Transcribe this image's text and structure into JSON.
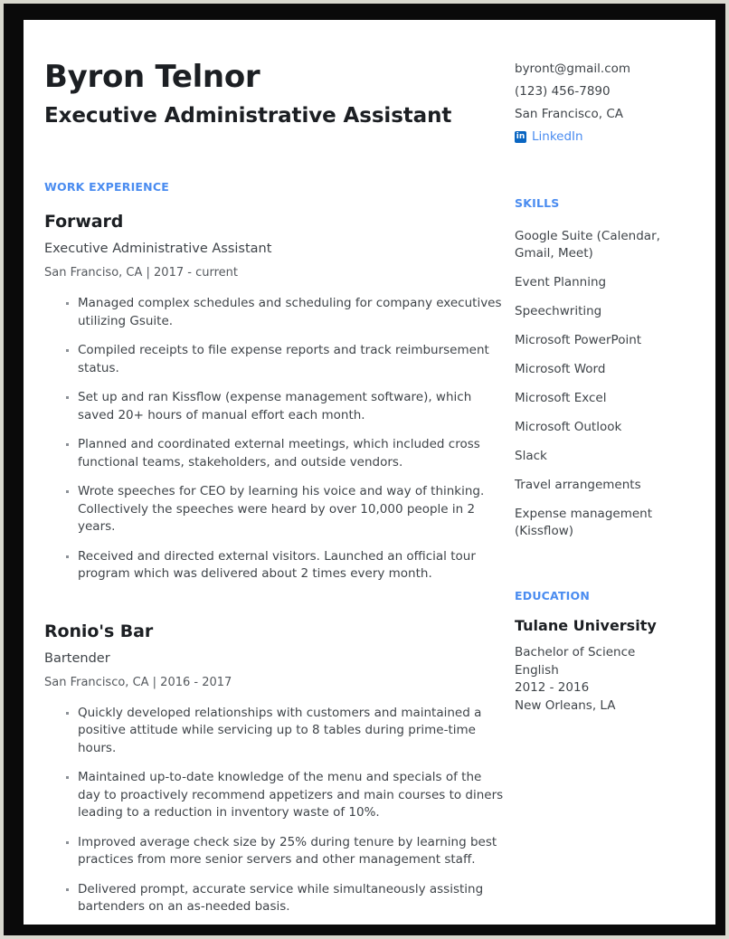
{
  "header": {
    "name": "Byron Telnor",
    "headline": "Executive Administrative Assistant"
  },
  "contact": {
    "email": "byront@gmail.com",
    "phone": "(123) 456-7890",
    "location": "San Francisco, CA",
    "linkedin_label": "LinkedIn",
    "linkedin_icon": "linkedin-icon",
    "link_color": "#4a8cf0",
    "icon_color": "#0a66c2"
  },
  "sections": {
    "work_experience_heading": "WORK EXPERIENCE",
    "skills_heading": "SKILLS",
    "education_heading": "EDUCATION",
    "heading_color": "#4a8cf0"
  },
  "jobs": [
    {
      "company": "Forward",
      "title": "Executive Administrative Assistant",
      "meta": "San Franciso, CA | 2017 - current",
      "bullets": [
        "Managed complex schedules and scheduling for company executives utilizing Gsuite.",
        "Compiled receipts to file expense reports and track reimbursement status.",
        "Set up and ran Kissflow (expense management software), which saved 20+ hours of manual effort each month.",
        "Planned and coordinated external meetings, which included cross functional teams, stakeholders, and outside vendors.",
        "Wrote speeches for CEO by learning his voice and way of thinking. Collectively the speeches were heard by over 10,000 people in 2 years.",
        "Received and directed external visitors. Launched an official tour program which was delivered about 2 times every month."
      ]
    },
    {
      "company": "Ronio's Bar",
      "title": "Bartender",
      "meta": "San Francisco, CA | 2016 - 2017",
      "bullets": [
        "Quickly developed relationships with customers and maintained a positive attitude while servicing up to 8 tables during prime-time hours.",
        "Maintained up-to-date knowledge of the menu and specials of the day to proactively recommend appetizers and main courses to diners leading to a reduction in inventory waste of 10%.",
        "Improved average check size by 25% during tenure by learning best practices from more senior servers and other management staff.",
        "Delivered prompt, accurate service while simultaneously assisting bartenders on an as-needed basis."
      ]
    }
  ],
  "skills": [
    "Google Suite (Calendar, Gmail, Meet)",
    "Event Planning",
    "Speechwriting",
    "Microsoft PowerPoint",
    "Microsoft Word",
    "Microsoft Excel",
    "Microsoft Outlook",
    "Slack",
    "Travel arrangements",
    "Expense management (Kissflow)"
  ],
  "education": {
    "school": "Tulane University",
    "degree": "Bachelor of Science",
    "field": "English",
    "years": "2012 - 2016",
    "location": "New Orleans, LA"
  }
}
